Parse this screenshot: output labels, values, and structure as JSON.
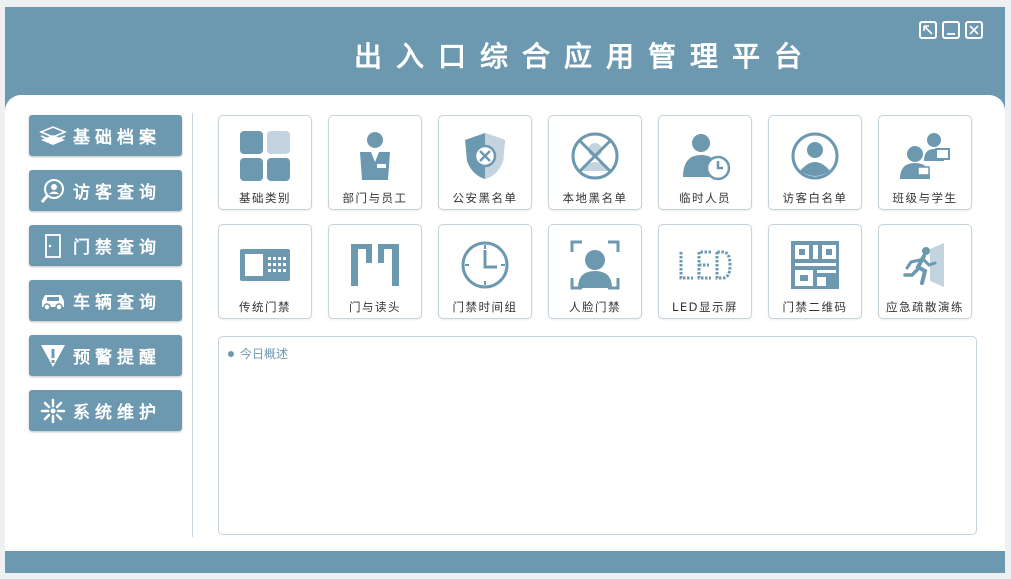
{
  "app": {
    "title": "出入口综合应用管理平台"
  },
  "colors": {
    "accent": "#6c98b0",
    "accent_light": "#c3d4de",
    "text": "#333333"
  },
  "window_controls": [
    {
      "name": "restore",
      "icon": "restore-icon"
    },
    {
      "name": "minimize",
      "icon": "minimize-icon"
    },
    {
      "name": "close",
      "icon": "close-icon"
    }
  ],
  "sidebar": {
    "items": [
      {
        "label": "基础档案",
        "icon": "books-icon"
      },
      {
        "label": "访客查询",
        "icon": "visitor-search-icon"
      },
      {
        "label": "门禁查询",
        "icon": "door-icon"
      },
      {
        "label": "车辆查询",
        "icon": "car-icon"
      },
      {
        "label": "预警提醒",
        "icon": "warning-icon"
      },
      {
        "label": "系统维护",
        "icon": "gear-icon"
      }
    ]
  },
  "tiles": {
    "row1": [
      {
        "label": "基础类别",
        "icon": "category-grid-icon"
      },
      {
        "label": "部门与员工",
        "icon": "employee-icon"
      },
      {
        "label": "公安黑名单",
        "icon": "police-shield-icon"
      },
      {
        "label": "本地黑名单",
        "icon": "blocked-person-icon"
      },
      {
        "label": "临时人员",
        "icon": "temp-person-clock-icon"
      },
      {
        "label": "访客白名单",
        "icon": "visitor-person-icon"
      },
      {
        "label": "班级与学生",
        "icon": "teacher-student-icon"
      }
    ],
    "row2": [
      {
        "label": "传统门禁",
        "icon": "card-reader-icon"
      },
      {
        "label": "门与读头",
        "icon": "door-reader-icon"
      },
      {
        "label": "门禁时间组",
        "icon": "clock-icon"
      },
      {
        "label": "人脸门禁",
        "icon": "face-scan-icon"
      },
      {
        "label": "LED显示屏",
        "icon": "led-icon"
      },
      {
        "label": "门禁二维码",
        "icon": "qrcode-icon"
      },
      {
        "label": "应急疏散演练",
        "icon": "emergency-exit-icon"
      }
    ]
  },
  "summary": {
    "title": "今日概述"
  }
}
